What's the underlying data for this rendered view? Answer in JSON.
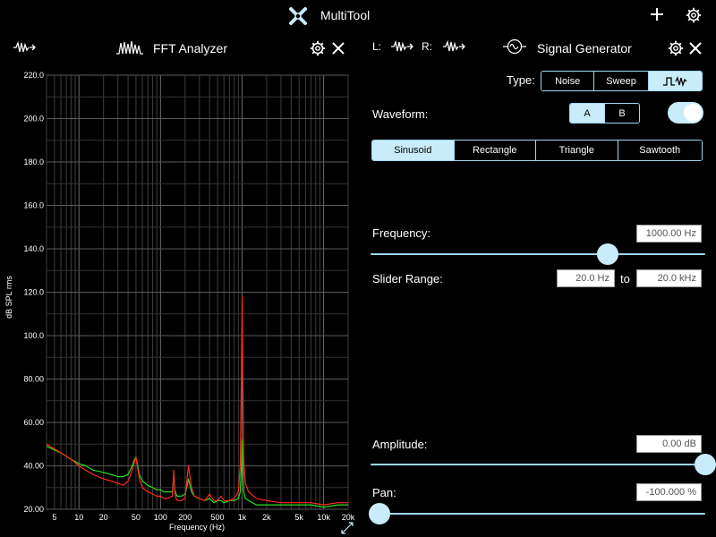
{
  "app": {
    "title": "MultiTool"
  },
  "analyzer": {
    "title": "FFT Analyzer",
    "chart_data": {
      "type": "line",
      "xlabel": "Frequency (Hz)",
      "ylabel": "dB SPL rms",
      "x_scale": "log",
      "xlim": [
        4,
        20000
      ],
      "ylim": [
        20,
        220
      ],
      "grid": true,
      "x_ticks": [
        5,
        10,
        20,
        50,
        100,
        200,
        500,
        1000,
        2000,
        5000,
        10000,
        20000
      ],
      "x_tick_labels": [
        "5",
        "10",
        "20",
        "50",
        "100",
        "200",
        "500",
        "1k",
        "2k",
        "5k",
        "10k",
        "20k"
      ],
      "y_ticks": [
        20,
        40,
        60,
        80,
        100,
        120,
        140,
        160,
        180,
        200,
        220
      ],
      "y_tick_labels": [
        "20.00",
        "40.00",
        "60.00",
        "80.00",
        "100.0",
        "120.0",
        "140.0",
        "160.0",
        "180.0",
        "200.0",
        "220.0"
      ],
      "series": [
        {
          "color": "#ff2a1a",
          "x": [
            4,
            6,
            8,
            10,
            12,
            15,
            20,
            25,
            30,
            35,
            40,
            45,
            48,
            50,
            52,
            55,
            60,
            70,
            80,
            90,
            100,
            110,
            120,
            140,
            145,
            150,
            155,
            160,
            180,
            200,
            210,
            220,
            240,
            260,
            300,
            350,
            400,
            450,
            500,
            550,
            600,
            700,
            800,
            900,
            950,
            980,
            1000,
            1020,
            1050,
            1100,
            1200,
            1500,
            2000,
            3000,
            5000,
            7000,
            10000,
            15000,
            20000
          ],
          "y": [
            50,
            46,
            43,
            40,
            38,
            36,
            34,
            33,
            32,
            31,
            33,
            38,
            42,
            44,
            40,
            34,
            30,
            28,
            27,
            26,
            26,
            25,
            25,
            26,
            38,
            28,
            25,
            24,
            24,
            25,
            33,
            40,
            30,
            26,
            25,
            24,
            27,
            24,
            24,
            26,
            24,
            24,
            25,
            28,
            40,
            80,
            118,
            82,
            42,
            32,
            28,
            25,
            24,
            23,
            23,
            23,
            22,
            23,
            23
          ]
        },
        {
          "color": "#22e01c",
          "x": [
            4,
            6,
            8,
            10,
            12,
            15,
            20,
            25,
            30,
            35,
            40,
            45,
            48,
            50,
            52,
            55,
            60,
            70,
            80,
            90,
            100,
            110,
            120,
            140,
            145,
            150,
            155,
            160,
            180,
            200,
            210,
            220,
            240,
            260,
            300,
            350,
            400,
            450,
            500,
            550,
            600,
            700,
            800,
            900,
            950,
            980,
            1000,
            1020,
            1050,
            1100,
            1200,
            1500,
            2000,
            3000,
            5000,
            7000,
            10000,
            15000,
            20000
          ],
          "y": [
            49,
            46,
            43,
            41,
            40,
            38,
            37,
            36,
            35,
            35,
            36,
            40,
            43,
            44,
            41,
            36,
            33,
            31,
            30,
            29,
            29,
            28,
            28,
            28,
            36,
            29,
            27,
            26,
            26,
            27,
            30,
            34,
            28,
            26,
            25,
            24,
            25,
            23,
            24,
            24,
            23,
            24,
            24,
            25,
            28,
            40,
            52,
            40,
            28,
            25,
            24,
            22,
            22,
            22,
            22,
            22,
            21,
            22,
            22
          ]
        }
      ]
    }
  },
  "channels": {
    "left_label": "L:",
    "right_label": "R:"
  },
  "generator": {
    "title": "Signal Generator",
    "type_label": "Type:",
    "type_options": [
      "Noise",
      "Sweep"
    ],
    "waveform_label": "Waveform:",
    "waveform_channels": [
      "A",
      "B"
    ],
    "waveform_toggle_on": true,
    "waveforms": [
      "Sinusoid",
      "Rectangle",
      "Triangle",
      "Sawtooth"
    ],
    "frequency_label": "Frequency:",
    "frequency_value": "1000.00 Hz",
    "frequency_slider_fraction": 0.7,
    "slider_range_label": "Slider Range:",
    "range_from": "20.0 Hz",
    "range_to_label": "to",
    "range_to": "20.0 kHz",
    "amplitude_label": "Amplitude:",
    "amplitude_value": "0.00 dB",
    "amplitude_slider_fraction": 1.0,
    "pan_label": "Pan:",
    "pan_value": "-100.000 %",
    "pan_slider_fraction": 0.0
  },
  "colors": {
    "accent": "#c9ecfb",
    "accent_border": "#9fd8f0",
    "spectrum_left": "#ff2a1a",
    "spectrum_right": "#22e01c"
  }
}
